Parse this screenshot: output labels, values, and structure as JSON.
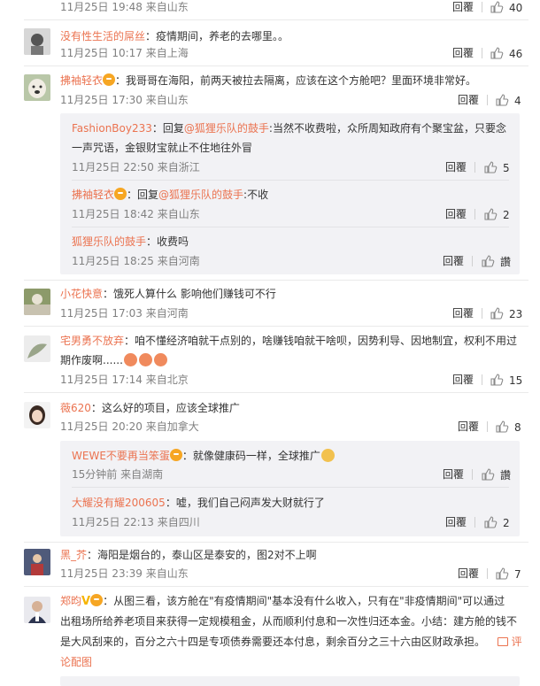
{
  "top": {
    "meta": "11月25日 19:48 来自山东",
    "reply": "回覆",
    "likes": "40"
  },
  "comments": [
    {
      "user": "没有性生活的屌丝",
      "text": "：疫情期间，养老的去哪里。。",
      "meta": "11月25日 10:17 来自上海",
      "reply": "回覆",
      "likes": "46"
    },
    {
      "user": "拂袖轻衣",
      "text": "：我哥哥在海阳，前两天被拉去隔离，应该在这个方舱吧？里面环境非常好。",
      "meta": "11月25日 17:30 来自山东",
      "reply": "回覆",
      "likes": "4",
      "replies": [
        {
          "user": "FashionBoy233",
          "prefix": "：回复",
          "mention": "@狐狸乐队的鼓手",
          "text_line1": ":当然不收费啦，众所周知政府有个聚宝盆，只要念",
          "text_line2": "一声咒语，金银财宝就止不住地往外冒",
          "meta": "11月25日 22:50 来自浙江",
          "reply": "回覆",
          "likes": "5"
        },
        {
          "user": "拂袖轻衣",
          "prefix": "：回复",
          "mention": "@狐狸乐队的鼓手",
          "text": ":不收",
          "meta": "11月25日 18:42 来自山东",
          "reply": "回覆",
          "likes": "2"
        },
        {
          "user": "狐狸乐队的鼓手",
          "text": "：收费吗",
          "meta": "11月25日 18:25 来自河南",
          "reply": "回覆",
          "likes": "讚"
        }
      ]
    },
    {
      "user": "小花快意",
      "text": "：饿死人算什么 影响他们赚钱可不行",
      "meta": "11月25日 17:03 来自河南",
      "reply": "回覆",
      "likes": "23"
    },
    {
      "user": "宅男勇不放弃",
      "text_line1": "：咱不懂经济咱就干点别的，啥赚钱咱就干啥呗，因势利导、因地制宜，权利不用过",
      "text_line2": "期作废啊......",
      "meta": "11月25日 17:14 来自北京",
      "reply": "回覆",
      "likes": "15"
    },
    {
      "user": "薇620",
      "text": "：这么好的项目，应该全球推广",
      "meta": "11月25日 20:20 来自加拿大",
      "reply": "回覆",
      "likes": "8",
      "replies": [
        {
          "user": "WEWE不要再当笨蛋",
          "text": "：就像健康码一样，全球推广",
          "meta": "15分钟前 来自湖南",
          "reply": "回覆",
          "likes": "讚"
        },
        {
          "user": "大耀没有耀200605",
          "text": "：嘘，我们自己闷声发大财就行了",
          "meta": "11月25日 22:13 来自四川",
          "reply": "回覆",
          "likes": "2"
        }
      ]
    },
    {
      "user": "黑_芥",
      "text": "：海阳是烟台的，泰山区是泰安的，图2对不上啊",
      "meta": "11月25日 23:39 来自山东",
      "reply": "回覆",
      "likes": "7"
    },
    {
      "user": "郑昀",
      "text_line1": "：从图三看，该方舱在\"有疫情期间\"基本没有什么收入，只有在\"非疫情期间\"可以通过",
      "text_line2": "出租场所给养老项目来获得一定规模租金，从而顺利付息和一次性归还本金。小结：建方舱的钱不",
      "text_line3": "是大风刮来的，百分之六十四是专项债券需要还本付息，剩余百分之三十六由区财政承担。",
      "link1": "评",
      "link2": "论配图"
    }
  ],
  "colors": {
    "username": "#eb7350",
    "subbox": "#f2f2f5",
    "meta": "#808080"
  }
}
